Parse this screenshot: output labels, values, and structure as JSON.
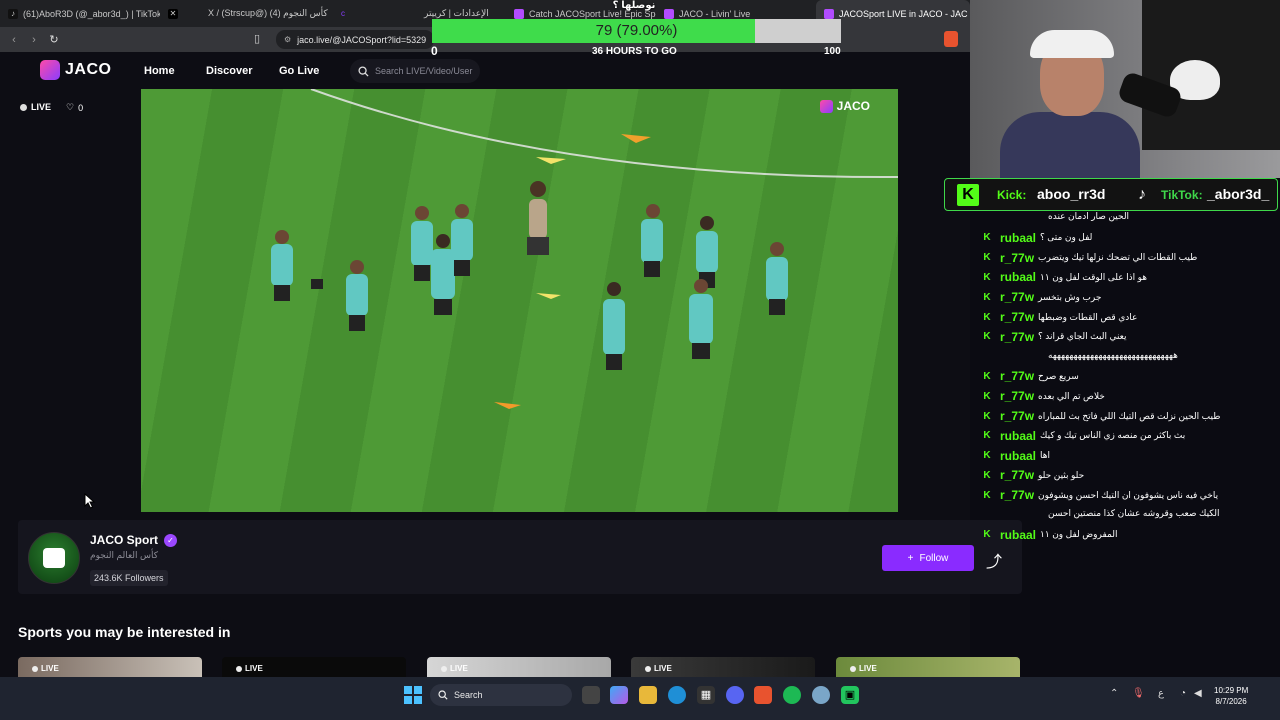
{
  "browser": {
    "tabs": [
      {
        "label": "(61)AboR3D (@_abor3d_) | TikTok",
        "icon": "tiktok-icon",
        "color": "#111111"
      },
      {
        "label": "",
        "icon": "x-icon",
        "color": "#000000"
      },
      {
        "label": "X / (Strscup@) كأس النجوم (4)",
        "icon": "x-icon",
        "color": "#000000"
      },
      {
        "label": "",
        "icon": "kick-icon",
        "color": "#8a3dff"
      },
      {
        "label": "الإعدادات | كرييتر",
        "icon": "settings-icon",
        "color": "#555555"
      },
      {
        "label": "Catch JACOSport Live! Epic Sports",
        "icon": "jaco-icon",
        "color": "#b14cff"
      },
      {
        "label": "JACO - Livin' Live",
        "icon": "jaco-icon",
        "color": "#b14cff"
      },
      {
        "label": "JACOSport LIVE in JACO - JAC",
        "icon": "jaco-icon",
        "color": "#b14cff",
        "active": true
      }
    ],
    "url": "jaco.live/@JACOSport?lid=5329"
  },
  "goal": {
    "title": "نوصلها ؟",
    "progress_text": "79 (79.00%)",
    "progress_fraction": 0.79,
    "min": "0",
    "max": "100",
    "subtitle": "36 HOURS TO GO"
  },
  "site": {
    "logo": "JACO",
    "nav": [
      "Home",
      "Discover",
      "Go Live"
    ],
    "search_placeholder": "Search LIVE/Video/User",
    "live_label": "LIVE",
    "likes": "0",
    "video_watermark": "JACO",
    "channel": {
      "name": "JACO Sport",
      "subtitle": "كأس العالم النجوم",
      "followers": "243.6K Followers",
      "follow_label": "Follow"
    },
    "section_title": "Sports you may be interested in",
    "thumb_live": "LIVE"
  },
  "socials": {
    "kick_label": "Kick:",
    "kick_handle": "aboo_rr3d",
    "tiktok_label": "TikTok:",
    "tiktok_handle": "_abor3d_"
  },
  "chat": [
    {
      "user": "",
      "text": "الحين صار ادمان عنده",
      "cont": true
    },
    {
      "user": "rubaal",
      "text": "لفل ون متى ؟"
    },
    {
      "user": "r_77w",
      "text": "طيب القطات الي تضحك نزلها تيك ويتضرب"
    },
    {
      "user": "rubaal",
      "text": "هو اذا على الوقت لفل ون ١١"
    },
    {
      "user": "r_77w",
      "text": "جرب وش بتخسر"
    },
    {
      "user": "r_77w",
      "text": "عادي قص القطات وضبطها"
    },
    {
      "user": "r_77w",
      "text": "يعني البث الجاي قراند ؟"
    },
    {
      "user": "",
      "text": "ههههههههههههههههههههههههههههههه",
      "cont": true
    },
    {
      "user": "r_77w",
      "text": "سريع صرح"
    },
    {
      "user": "r_77w",
      "text": "خلاص تم الي بعده"
    },
    {
      "user": "r_77w",
      "text": "طيب الحين نزلت قص التيك اللي فاتح بث للمباراه"
    },
    {
      "user": "rubaal",
      "text": "بث باكثر من منصه زي الناس تيك و كيك"
    },
    {
      "user": "rubaal",
      "text": "اها"
    },
    {
      "user": "r_77w",
      "text": "حلو بثين حلو"
    },
    {
      "user": "r_77w",
      "text": "ياخي فيه ناس يشوفون ان التيك احسن ويشوفون"
    },
    {
      "user": "",
      "text": "الكيك صعب وقروشه عشان كذا منصتين احسن",
      "cont": true
    },
    {
      "user": "rubaal",
      "text": "المفروض لفل ون ١١"
    }
  ],
  "taskbar": {
    "search_label": "Search",
    "time": "10:29 PM",
    "date": "8/7/2026",
    "lang": "ع"
  },
  "colors": {
    "accent": "#8a2bff",
    "kick_green": "#53fc18",
    "goal_fill": "#3fdc4b"
  }
}
